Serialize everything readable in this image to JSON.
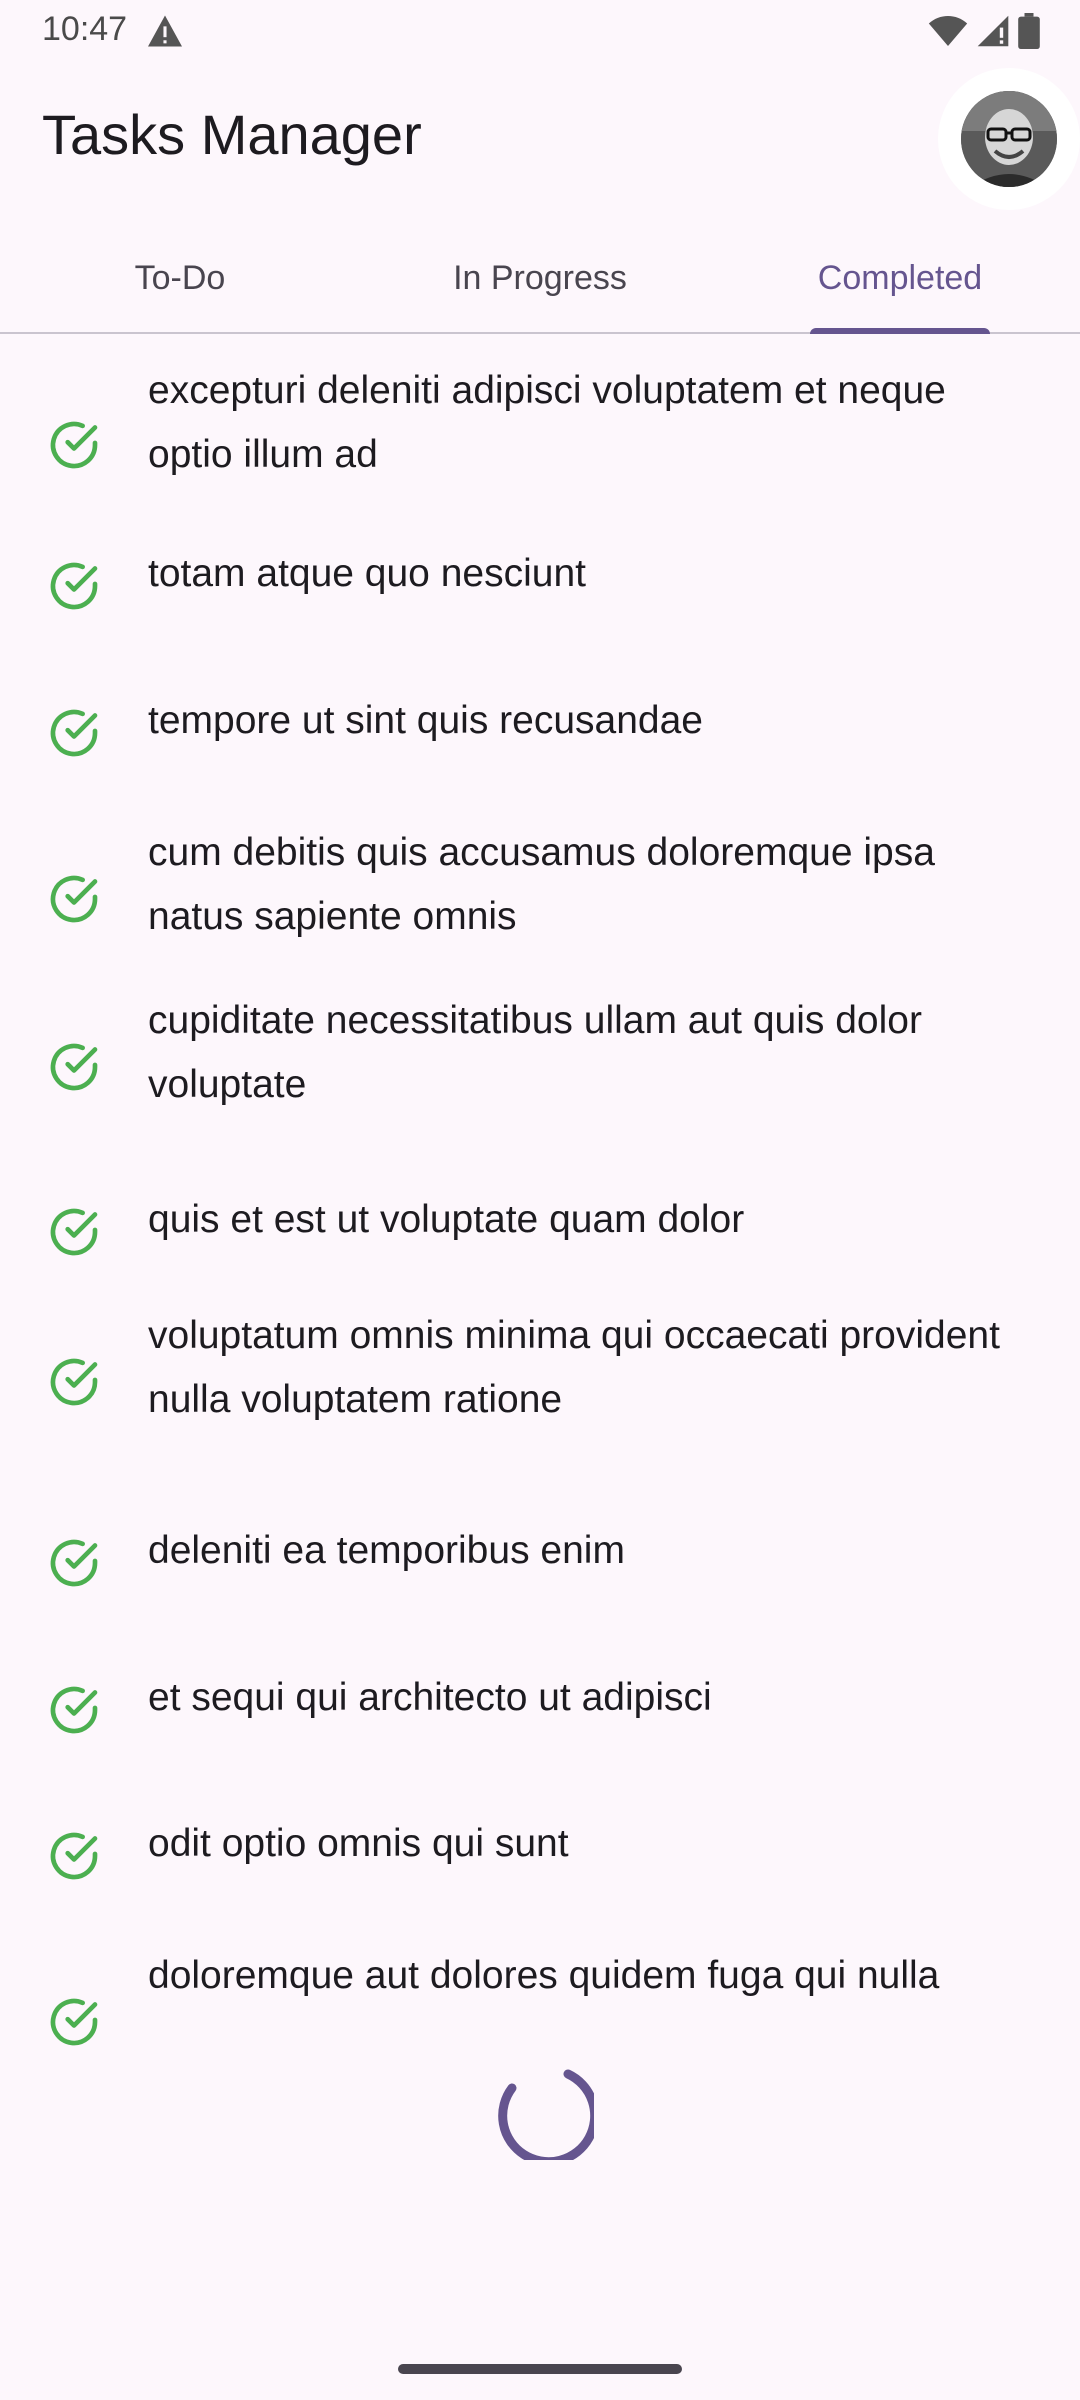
{
  "status_bar": {
    "time": "10:47"
  },
  "app_bar": {
    "title": "Tasks Manager"
  },
  "tabs": [
    {
      "label": "To-Do",
      "active": false
    },
    {
      "label": "In Progress",
      "active": false
    },
    {
      "label": "Completed",
      "active": true
    }
  ],
  "tasks": [
    {
      "text": "excepturi deleniti adipisci voluptatem et neque optio illum ad",
      "status": "completed"
    },
    {
      "text": "totam atque quo nesciunt",
      "status": "completed"
    },
    {
      "text": "tempore ut sint quis recusandae",
      "status": "completed"
    },
    {
      "text": "cum debitis quis accusamus doloremque ipsa natus sapiente omnis",
      "status": "completed"
    },
    {
      "text": "cupiditate necessitatibus ullam aut quis dolor voluptate",
      "status": "completed"
    },
    {
      "text": "quis et est ut voluptate quam dolor",
      "status": "completed"
    },
    {
      "text": "voluptatum omnis minima qui occaecati provident nulla voluptatem ratione",
      "status": "completed"
    },
    {
      "text": "deleniti ea temporibus enim",
      "status": "completed"
    },
    {
      "text": "et sequi qui architecto ut adipisci",
      "status": "completed"
    },
    {
      "text": "odit optio omnis qui sunt",
      "status": "completed"
    },
    {
      "text": "doloremque aut dolores quidem fuga qui nulla",
      "status": "completed"
    }
  ],
  "colors": {
    "accent": "#65558f",
    "check": "#4caf50",
    "background": "#fdf7fc"
  },
  "icons": {
    "status_warning": "warning-icon",
    "wifi": "wifi-icon",
    "signal": "signal-icon",
    "battery": "battery-icon",
    "task_check": "check-circle-icon",
    "loading": "progress-spinner-icon"
  }
}
